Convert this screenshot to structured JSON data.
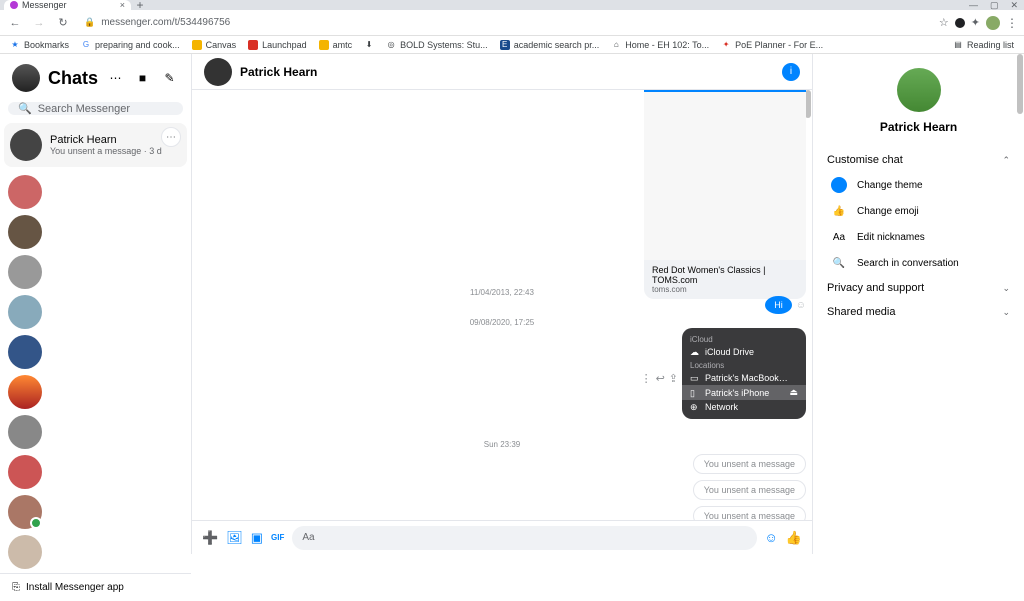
{
  "browser": {
    "tab_title": "Messenger",
    "url": "messenger.com/t/534496756",
    "new_tab": "+",
    "close_tab": "×",
    "nav": {
      "back": "←",
      "fwd": "→",
      "reload": "↻",
      "lock": "🔒",
      "star": "☆",
      "puzzle": "✦",
      "menu": "⋮"
    },
    "bookmarks": [
      {
        "icon": "★",
        "color": "#1a73e8",
        "label": "Bookmarks"
      },
      {
        "icon": "G",
        "color": "#4285f4",
        "label": "preparing and cook..."
      },
      {
        "icon": "",
        "color": "#f4b400",
        "label": "Canvas"
      },
      {
        "icon": "",
        "color": "#d93025",
        "label": "Launchpad"
      },
      {
        "icon": "",
        "color": "#f4b400",
        "label": "amtc"
      },
      {
        "icon": "⬇",
        "color": "#5f6368",
        "label": ""
      },
      {
        "icon": "◎",
        "color": "#5f6368",
        "label": "BOLD Systems: Stu..."
      },
      {
        "icon": "E",
        "color": "#1a4b8c",
        "label": "academic search pr..."
      },
      {
        "icon": "⌂",
        "color": "#5f6368",
        "label": "Home - EH 102: To..."
      },
      {
        "icon": "✦",
        "color": "#d93025",
        "label": "PoE Planner - For E..."
      }
    ],
    "reading_list": "Reading list"
  },
  "chats": {
    "title": "Chats",
    "menu": "⋯",
    "video": "■",
    "compose": "✎",
    "search_icon": "🔍",
    "search_placeholder": "Search Messenger",
    "active": {
      "name": "Patrick Hearn",
      "sub": "You unsent a message · 3 d"
    },
    "install_icon": "⎘",
    "install": "Install Messenger app"
  },
  "conv": {
    "name": "Patrick Hearn",
    "info": "i",
    "link_title": "Red Dot Women's Classics | TOMS.com",
    "link_domain": "toms.com",
    "ts1": "11/04/2013, 22:43",
    "ts2": "09/08/2020, 17:25",
    "ts3": "Sun 23:39",
    "hi": "Hi",
    "popup": {
      "sec1": "iCloud",
      "drive": "iCloud Drive",
      "sec2": "Locations",
      "mac": "Patrick's MacBook…",
      "iphone": "Patrick's iPhone",
      "eject": "⏏",
      "net": "Network"
    },
    "unsent": "You unsent a message",
    "compose": {
      "plus": "➕",
      "photo": "🖼",
      "sticker": "▣",
      "gif": "GIF",
      "placeholder": "Aa",
      "emoji": "☺",
      "like": "👍"
    }
  },
  "details": {
    "name": "Patrick Hearn",
    "customise": "Customise chat",
    "opts": {
      "theme": "Change theme",
      "emoji": "Change emoji",
      "nick": "Edit nicknames",
      "search": "Search in conversation"
    },
    "privacy": "Privacy and support",
    "media": "Shared media",
    "up": "⌃",
    "down": "⌄",
    "aa": "Aa",
    "mag": "🔍",
    "thumb": "👍"
  }
}
